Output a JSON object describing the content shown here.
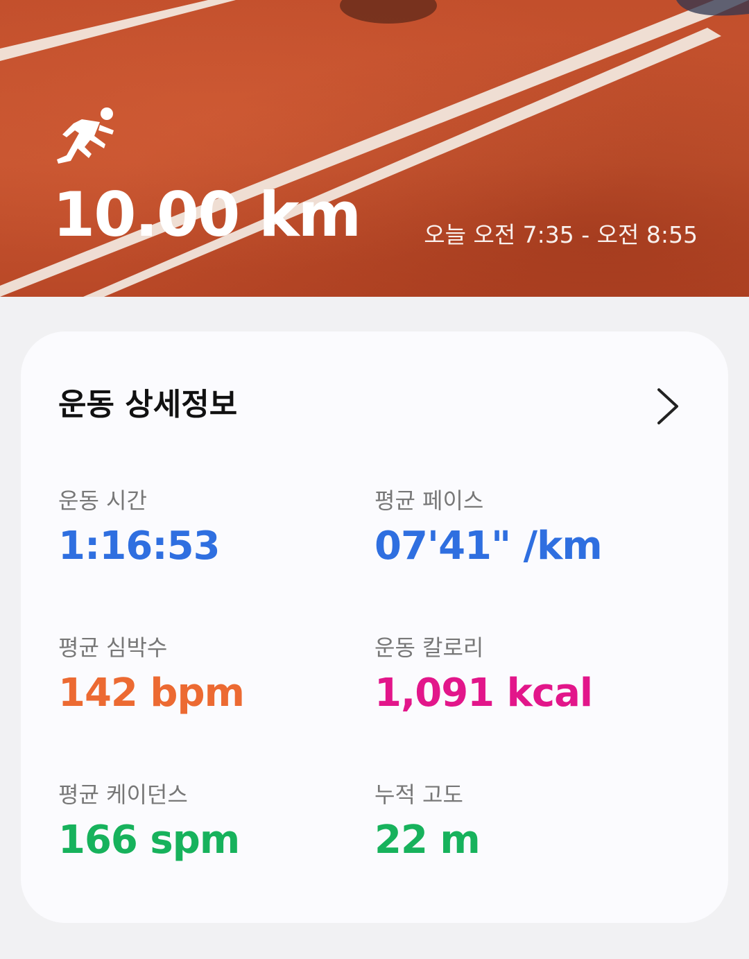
{
  "workout": {
    "distance": "10.00 km",
    "time_range": "오늘 오전 7:35 - 오전 8:55"
  },
  "details": {
    "title": "운동 상세정보",
    "stats": [
      {
        "label": "운동 시간",
        "value": "1:16:53",
        "unit": "",
        "color": "#2f6fe0"
      },
      {
        "label": "평균 페이스",
        "value": "07'41\"",
        "unit": " /km",
        "color": "#2f6fe0"
      },
      {
        "label": "평균 심박수",
        "value": "142",
        "unit": " bpm",
        "color": "#ec6a32"
      },
      {
        "label": "운동 칼로리",
        "value": "1,091",
        "unit": " kcal",
        "color": "#e2168a"
      },
      {
        "label": "평균 케이던스",
        "value": "166",
        "unit": " spm",
        "color": "#17b25c"
      },
      {
        "label": "누적 고도",
        "value": "22",
        "unit": " m",
        "color": "#17b25c"
      }
    ]
  },
  "icons": {
    "activity": "running-person-icon",
    "navigate": "chevron-right-icon"
  },
  "colors": {
    "track": "#c4502b",
    "card": "#fbfbfe",
    "background": "#f1f1f3"
  }
}
